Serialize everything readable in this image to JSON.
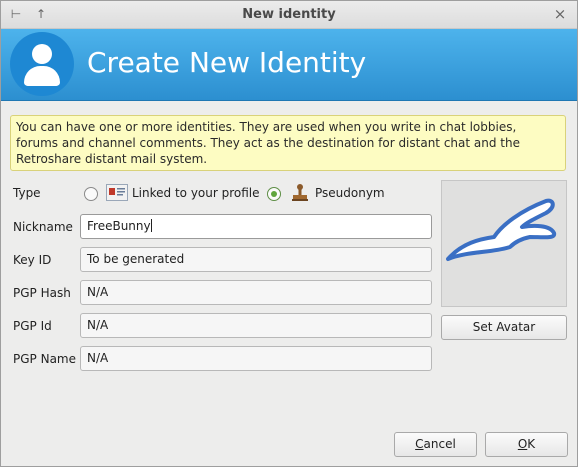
{
  "window": {
    "title": "New identity"
  },
  "header": {
    "title": "Create New Identity"
  },
  "info": {
    "text": "You can have one or more identities. They are used when you write in chat lobbies, forums and channel comments. They act as the destination for distant chat and the Retroshare distant mail system."
  },
  "form": {
    "type_label": "Type",
    "type_options": [
      {
        "label": "Linked to your profile",
        "checked": false
      },
      {
        "label": "Pseudonym",
        "checked": true
      }
    ],
    "nickname_label": "Nickname",
    "nickname_value": "FreeBunny",
    "keyid_label": "Key ID",
    "keyid_value": "To be generated",
    "pgphash_label": "PGP Hash",
    "pgphash_value": "N/A",
    "pgpid_label": "PGP Id",
    "pgpid_value": "N/A",
    "pgpname_label": "PGP Name",
    "pgpname_value": "N/A"
  },
  "avatar": {
    "button": "Set Avatar"
  },
  "footer": {
    "cancel_prefix": "",
    "cancel_ul": "C",
    "cancel_rest": "ancel",
    "ok_ul": "O",
    "ok_rest": "K"
  },
  "colors": {
    "header_blue": "#2c8fd0",
    "info_bg": "#fdfcc2",
    "radio_checked": "#5fa53c"
  }
}
